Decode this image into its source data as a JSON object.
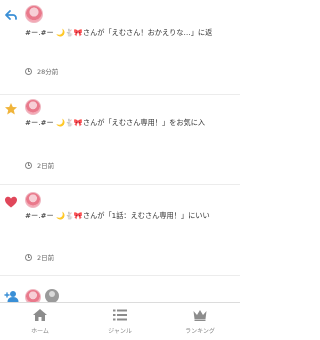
{
  "notifications": [
    {
      "type": "reply",
      "icon": "reply-icon",
      "actor_name": "#ー.#ー",
      "actor_emoji": [
        "🌙",
        "🐇",
        "🎀"
      ],
      "message": "さんが「えむさん！おかえりな…」に返",
      "time": "28分前"
    },
    {
      "type": "favorite",
      "icon": "star-icon",
      "actor_name": "#ー.#ー",
      "actor_emoji": [
        "🌙",
        "🐇",
        "🎀"
      ],
      "message": "さんが「えむさん専用！」をお気に入",
      "time": "2日前"
    },
    {
      "type": "like",
      "icon": "heart-icon",
      "actor_name": "#ー.#ー",
      "actor_emoji": [
        "🌙",
        "🐇",
        "🎀"
      ],
      "message": "さんが「1話：えむさん専用！」にいい",
      "time": "2日前"
    },
    {
      "type": "follow",
      "icon": "add-user-icon"
    }
  ],
  "tabbar": {
    "tabs": [
      {
        "label": "ホーム",
        "icon": "home-icon"
      },
      {
        "label": "ジャンル",
        "icon": "list-icon"
      },
      {
        "label": "ランキング",
        "icon": "crown-icon"
      }
    ]
  },
  "colors": {
    "accent_blue": "#3a8fd6",
    "star": "#f0b43a",
    "heart": "#e0475a",
    "muted": "#888888"
  }
}
